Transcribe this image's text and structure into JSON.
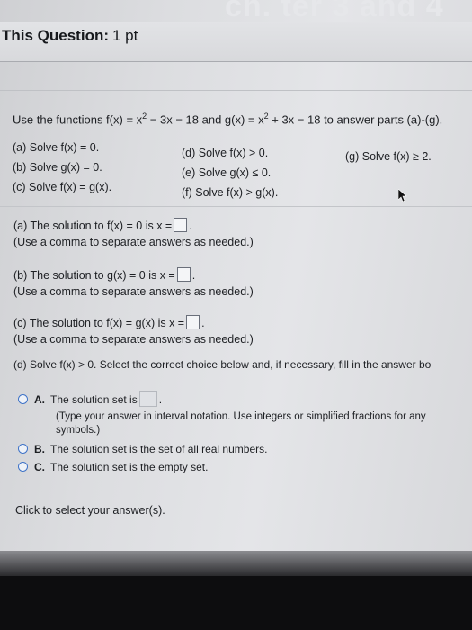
{
  "header": {
    "ghost_title": "ch. ter 3 and 4",
    "question_label": "This Question:",
    "question_points": "1 pt"
  },
  "problem": {
    "intro_pre": "Use the functions f(x) = x",
    "intro_exp1": "2",
    "intro_mid": " − 3x − 18 and g(x) = x",
    "intro_exp2": "2",
    "intro_post": " + 3x − 18 to answer parts (a)-(g).",
    "parts": {
      "a": "(a) Solve f(x) = 0.",
      "b": "(b) Solve g(x) = 0.",
      "c": "(c) Solve f(x) = g(x).",
      "d": "(d) Solve f(x) > 0.",
      "e": "(e) Solve g(x) ≤ 0.",
      "f": "(f) Solve f(x) > g(x).",
      "g": "(g) Solve f(x) ≥ 2."
    }
  },
  "answers": {
    "a_prompt": "(a) The solution to f(x) = 0 is x =",
    "a_hint": "(Use a comma to separate answers as needed.)",
    "b_prompt": "(b) The solution to g(x) = 0 is x =",
    "b_hint": "(Use a comma to separate answers as needed.)",
    "c_prompt": "(c) The solution to f(x) = g(x) is x =",
    "c_hint": "(Use a comma to separate answers as needed.)",
    "d_prompt": "(d) Solve f(x) > 0. Select the correct choice below and, if necessary, fill in the answer bo",
    "choice_a_letter": "A.",
    "choice_a_text": "The solution set is",
    "choice_a_hint_line1": "(Type your answer in interval notation. Use integers or simplified fractions for any",
    "choice_a_hint_line2": "symbols.)",
    "choice_b_letter": "B.",
    "choice_b_text": "The solution set is the set of all real numbers.",
    "choice_c_letter": "C.",
    "choice_c_text": "The solution set is the empty set."
  },
  "footer": {
    "click_note": "Click to select your answer(s)."
  },
  "colors": {
    "radio_border": "#3f73c8",
    "background": "#dcdde0"
  }
}
